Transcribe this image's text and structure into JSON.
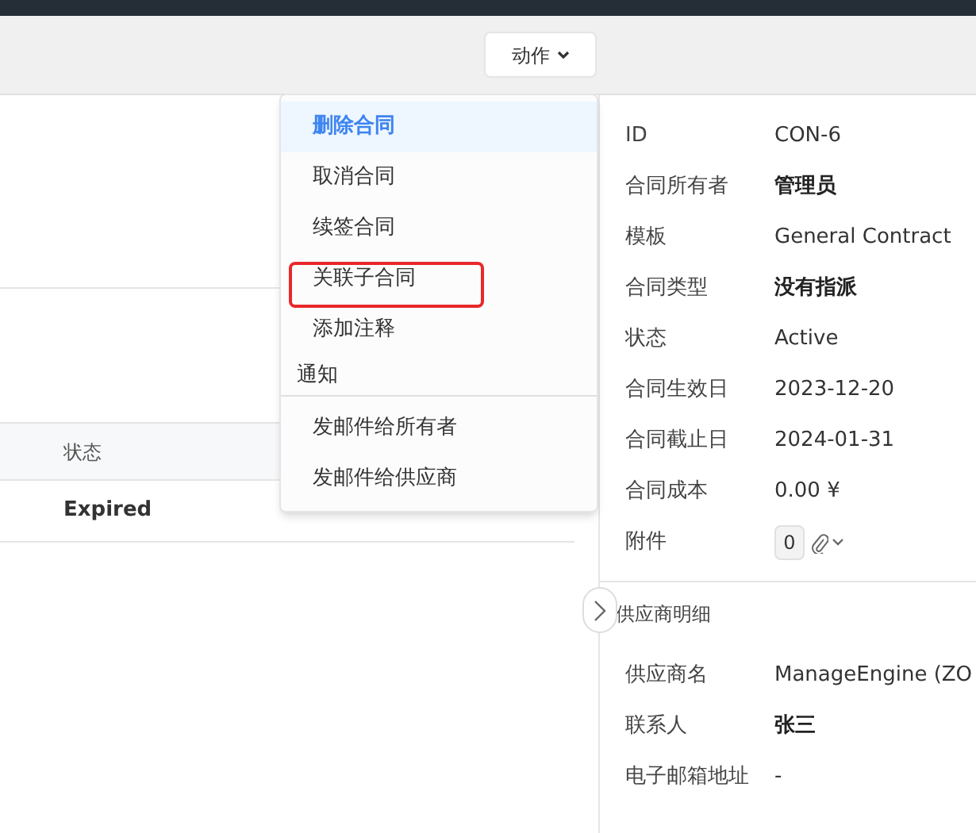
{
  "toolbar": {
    "action_button": {
      "label": "动作"
    }
  },
  "table": {
    "columns": [
      "状态"
    ],
    "rows": [
      [
        "Expired"
      ]
    ]
  },
  "action_menu": {
    "groups": [
      {
        "items": [
          {
            "label": "删除合同",
            "selected": true
          },
          {
            "label": "取消合同",
            "selected": false
          },
          {
            "label": "续签合同",
            "selected": false
          },
          {
            "label": "关联子合同",
            "selected": false,
            "highlighted": true
          },
          {
            "label": "添加注释",
            "selected": false
          }
        ]
      },
      {
        "heading": "通知",
        "items": [
          {
            "label": "发邮件给所有者",
            "selected": false
          },
          {
            "label": "发邮件给供应商",
            "selected": false
          }
        ]
      }
    ]
  },
  "details": {
    "fields": [
      {
        "label": "ID",
        "value": "CON-6",
        "bold": false
      },
      {
        "label": "合同所有者",
        "value": "管理员",
        "bold": true
      },
      {
        "label": "模板",
        "value": "General Contract",
        "bold": false
      },
      {
        "label": "合同类型",
        "value": "没有指派",
        "bold": true
      },
      {
        "label": "状态",
        "value": "Active",
        "bold": false
      },
      {
        "label": "合同生效日",
        "value": "2023-12-20",
        "bold": false
      },
      {
        "label": "合同截止日",
        "value": "2024-01-31",
        "bold": false
      },
      {
        "label": "合同成本",
        "value": "0.00 ¥",
        "bold": false
      }
    ],
    "attachments": {
      "label": "附件",
      "count": "0"
    }
  },
  "vendor": {
    "title": "供应商明细",
    "fields": [
      {
        "label": "供应商名",
        "value": "ManageEngine (ZO",
        "bold": false
      },
      {
        "label": "联系人",
        "value": "张三",
        "bold": true
      },
      {
        "label": "电子邮箱地址",
        "value": "-",
        "bold": false
      }
    ]
  }
}
